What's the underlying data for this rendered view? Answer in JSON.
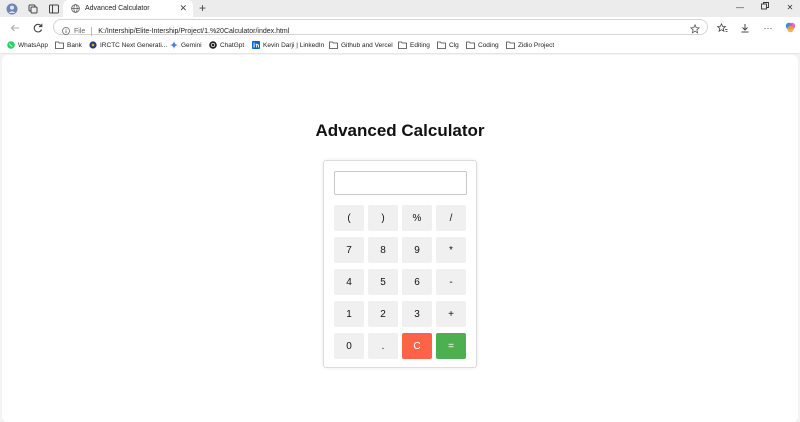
{
  "browser": {
    "tab": {
      "title": "Advanced Calculator"
    },
    "address": {
      "scheme": "File",
      "url": "K:/Intership/Elite-Intership/Project/1.%20Calculator/index.html"
    },
    "bookmarks": [
      {
        "label": "WhatsApp",
        "icon": "whatsapp-icon"
      },
      {
        "label": "Bank",
        "icon": "folder-icon"
      },
      {
        "label": "IRCTC Next Generati...",
        "icon": "irctc-icon"
      },
      {
        "label": "Gemini",
        "icon": "gemini-icon"
      },
      {
        "label": "ChatGpt",
        "icon": "chatgpt-icon"
      },
      {
        "label": "Kevin Darji | LinkedIn",
        "icon": "linkedin-icon"
      },
      {
        "label": "Github and Vercel",
        "icon": "folder-icon"
      },
      {
        "label": "Editing",
        "icon": "folder-icon"
      },
      {
        "label": "Clg",
        "icon": "folder-icon"
      },
      {
        "label": "Coding",
        "icon": "folder-icon"
      },
      {
        "label": "Zidio Project",
        "icon": "folder-icon"
      }
    ]
  },
  "page": {
    "title": "Advanced Calculator",
    "display": {
      "value": "",
      "placeholder": ""
    },
    "buttons": [
      {
        "label": "("
      },
      {
        "label": ")"
      },
      {
        "label": "%"
      },
      {
        "label": "/"
      },
      {
        "label": "7"
      },
      {
        "label": "8"
      },
      {
        "label": "9"
      },
      {
        "label": "*"
      },
      {
        "label": "4"
      },
      {
        "label": "5"
      },
      {
        "label": "6"
      },
      {
        "label": "-"
      },
      {
        "label": "1"
      },
      {
        "label": "2"
      },
      {
        "label": "3"
      },
      {
        "label": "+"
      },
      {
        "label": "0"
      },
      {
        "label": "."
      },
      {
        "label": "C"
      },
      {
        "label": "="
      }
    ]
  },
  "colors": {
    "clear": "#ff6347",
    "equals": "#4caf50",
    "key": "#f0f0f0"
  }
}
